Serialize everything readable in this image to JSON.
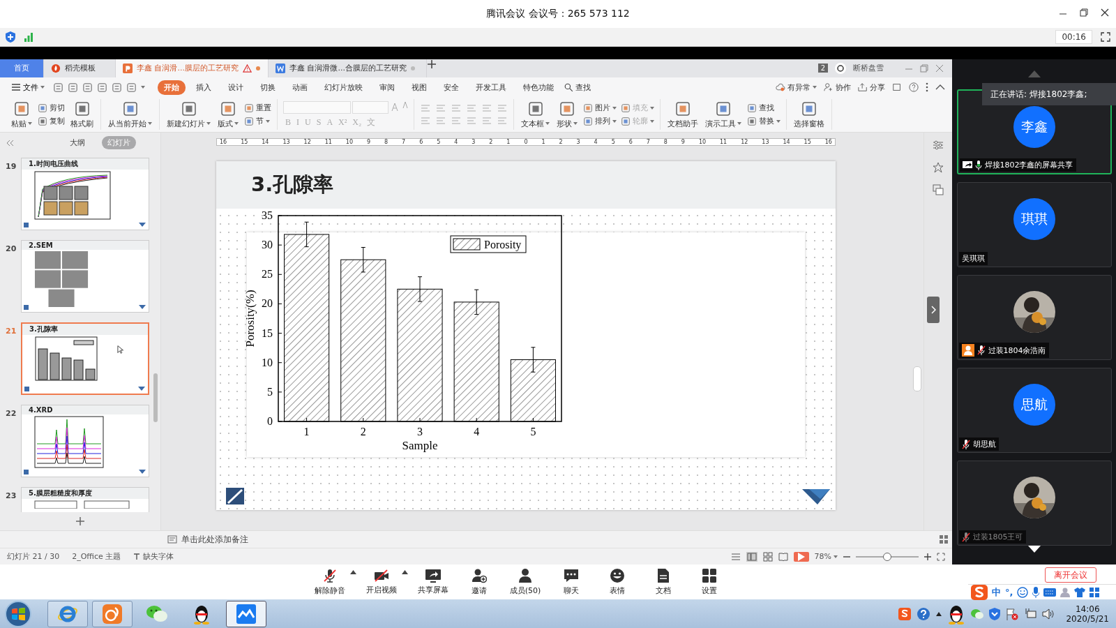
{
  "window": {
    "title": "腾讯会议 会议号：265 573 112"
  },
  "meeting_bar": {
    "timer": "00:16"
  },
  "wps": {
    "tabs": [
      {
        "label": "首页",
        "kind": "home",
        "selected": false,
        "warning": false,
        "unsaved": false
      },
      {
        "label": "稻壳模板",
        "kind": "docer",
        "selected": false,
        "warning": false,
        "unsaved": false
      },
      {
        "label": "李鑫 自润滑...膜层的工艺研究",
        "kind": "ppt",
        "selected": true,
        "warning": true,
        "unsaved": true
      },
      {
        "label": "李鑫 自润滑微...合膜层的工艺研究",
        "kind": "doc",
        "selected": false,
        "warning": false,
        "unsaved": true
      }
    ],
    "window_count": "2",
    "user": "断桥盘雪",
    "file_menu": "文件",
    "ribbon_tabs": [
      {
        "label": "开始",
        "selected": true
      },
      {
        "label": "插入",
        "selected": false
      },
      {
        "label": "设计",
        "selected": false
      },
      {
        "label": "切换",
        "selected": false
      },
      {
        "label": "动画",
        "selected": false
      },
      {
        "label": "幻灯片放映",
        "selected": false
      },
      {
        "label": "审阅",
        "selected": false
      },
      {
        "label": "视图",
        "selected": false
      },
      {
        "label": "安全",
        "selected": false
      },
      {
        "label": "开发工具",
        "selected": false
      },
      {
        "label": "特色功能",
        "selected": false
      }
    ],
    "search": "查找",
    "right_actions": [
      "有异常",
      "协作",
      "分享"
    ],
    "ribbon": [
      {
        "items": [
          {
            "kind": "large",
            "label": "粘贴",
            "dropdown": true
          },
          {
            "kind": "stack",
            "items": [
              {
                "label": "剪切",
                "dropdown": false,
                "disabled": false
              },
              {
                "label": "复制",
                "dropdown": false,
                "disabled": false
              }
            ]
          },
          {
            "kind": "large",
            "label": "格式刷",
            "dropdown": false
          }
        ]
      },
      {
        "items": [
          {
            "kind": "large",
            "label": "从当前开始",
            "dropdown": true
          }
        ]
      },
      {
        "items": [
          {
            "kind": "large",
            "label": "新建幻灯片",
            "dropdown": true
          },
          {
            "kind": "large",
            "label": "版式",
            "dropdown": true
          },
          {
            "kind": "stack",
            "items": [
              {
                "label": "重置",
                "dropdown": false,
                "disabled": false
              },
              {
                "label": "节",
                "dropdown": true,
                "disabled": false
              }
            ]
          }
        ]
      },
      {
        "items": [
          {
            "kind": "font",
            "disabled": true,
            "buttons": [
              "B",
              "I",
              "U",
              "S",
              "A",
              "X²",
              "X₂",
              "文"
            ]
          }
        ]
      },
      {
        "items": [
          {
            "kind": "paragraph",
            "disabled": true
          }
        ]
      },
      {
        "items": [
          {
            "kind": "large",
            "label": "文本框",
            "dropdown": true
          },
          {
            "kind": "large",
            "label": "形状",
            "dropdown": true
          },
          {
            "kind": "stack",
            "items": [
              {
                "label": "图片",
                "dropdown": true,
                "disabled": false
              },
              {
                "label": "排列",
                "dropdown": true,
                "disabled": false
              }
            ]
          },
          {
            "kind": "stack",
            "items": [
              {
                "label": "填充",
                "dropdown": true,
                "disabled": true
              },
              {
                "label": "轮廓",
                "dropdown": true,
                "disabled": true
              }
            ]
          }
        ]
      },
      {
        "items": [
          {
            "kind": "large",
            "label": "文档助手",
            "dropdown": false
          },
          {
            "kind": "large",
            "label": "演示工具",
            "dropdown": true
          },
          {
            "kind": "stack",
            "items": [
              {
                "label": "查找",
                "dropdown": false,
                "disabled": false
              },
              {
                "label": "替换",
                "dropdown": true,
                "disabled": false
              }
            ]
          }
        ]
      },
      {
        "items": [
          {
            "kind": "large",
            "label": "选择窗格",
            "dropdown": false
          }
        ]
      }
    ],
    "slide_views": [
      {
        "label": "大纲",
        "selected": false
      },
      {
        "label": "幻灯片",
        "selected": true
      }
    ],
    "slides": [
      {
        "number": "19",
        "title": "1.时间电压曲线",
        "kind": "line_chart",
        "selected": false
      },
      {
        "number": "20",
        "title": "2.SEM",
        "kind": "micrographs",
        "selected": false
      },
      {
        "number": "21",
        "title": "3.孔隙率",
        "kind": "bar_chart",
        "selected": true
      },
      {
        "number": "22",
        "title": "4.XRD",
        "kind": "spectra",
        "selected": false
      },
      {
        "number": "23",
        "title": "5.膜层粗糙度和厚度",
        "kind": "table",
        "selected": false
      }
    ],
    "ruler": [
      "16",
      "15",
      "14",
      "13",
      "12",
      "11",
      "10",
      "9",
      "8",
      "7",
      "6",
      "5",
      "4",
      "3",
      "2",
      "1",
      "0",
      "1",
      "2",
      "3",
      "4",
      "5",
      "6",
      "7",
      "8",
      "9",
      "10",
      "11",
      "12",
      "13",
      "14",
      "15",
      "16"
    ],
    "slide": {
      "title": "3.孔隙率",
      "chart_data": {
        "type": "bar",
        "xlabel": "Sample",
        "ylabel": "Porosity(%)",
        "categories": [
          "1",
          "2",
          "3",
          "4",
          "5"
        ],
        "series": [
          {
            "name": "Porosity",
            "color": "#000000",
            "values": [
              31.8,
              27.5,
              22.5,
              20.3,
              10.5
            ]
          }
        ],
        "ylim": [
          0,
          35
        ],
        "yticks": [
          0,
          5,
          10,
          15,
          20,
          25,
          30,
          35
        ]
      }
    },
    "notes_placeholder": "单击此处添加备注",
    "status": {
      "slide": "幻灯片 21 / 30",
      "theme": "2_Office 主题",
      "missing_font": "缺失字体",
      "zoom": "78%"
    },
    "zoom_slider": {
      "level": 0.5
    }
  },
  "participants": {
    "speaking": "正在讲话: 焊接1802李鑫;",
    "tiles": [
      {
        "kind": "initials",
        "avatar_text": "李鑫",
        "label": "焊接1802李鑫的屏幕共享",
        "sharing": true,
        "person_badge": false,
        "mic_on": true,
        "muted": false,
        "active": true,
        "dimmed": false
      },
      {
        "kind": "initials",
        "avatar_text": "琪琪",
        "label": "吴琪琪",
        "sharing": false,
        "person_badge": false,
        "mic_on": false,
        "muted": false,
        "active": false,
        "dimmed": false
      },
      {
        "kind": "picture",
        "label": "过装1804余浩南",
        "sharing": false,
        "person_badge": true,
        "mic_on": false,
        "muted": true,
        "active": false,
        "dimmed": false
      },
      {
        "kind": "initials",
        "avatar_text": "思航",
        "label": "胡思航",
        "sharing": false,
        "person_badge": false,
        "mic_on": false,
        "muted": true,
        "active": false,
        "dimmed": false
      },
      {
        "kind": "picture",
        "label": "过装1805王可",
        "sharing": false,
        "person_badge": false,
        "mic_on": false,
        "muted": true,
        "active": false,
        "dimmed": true
      }
    ]
  },
  "toolbar": [
    {
      "label": "解除静音",
      "kind": "unmute",
      "menu": true
    },
    {
      "label": "开启视频",
      "kind": "video",
      "menu": true
    },
    {
      "label": "共享屏幕",
      "kind": "share",
      "menu": false
    },
    {
      "label": "邀请",
      "kind": "invite",
      "menu": false
    },
    {
      "label": "成员(50)",
      "kind": "members",
      "menu": false
    },
    {
      "label": "聊天",
      "kind": "chat",
      "menu": false
    },
    {
      "label": "表情",
      "kind": "emoji",
      "menu": false
    },
    {
      "label": "文档",
      "kind": "docs",
      "menu": false
    },
    {
      "label": "设置",
      "kind": "settings",
      "menu": false
    }
  ],
  "leave_button": "离开会议",
  "ime": {
    "mode": "中",
    "punctuation": "°,"
  },
  "taskbar": {
    "apps": [
      {
        "kind": "ie",
        "running": true,
        "selected": false
      },
      {
        "kind": "uc",
        "running": true,
        "selected": false
      },
      {
        "kind": "wechat",
        "running": false,
        "selected": false
      },
      {
        "kind": "qq",
        "running": false,
        "selected": false
      },
      {
        "kind": "meeting",
        "running": true,
        "selected": true
      }
    ],
    "time": "14:06",
    "date": "2020/5/21"
  }
}
